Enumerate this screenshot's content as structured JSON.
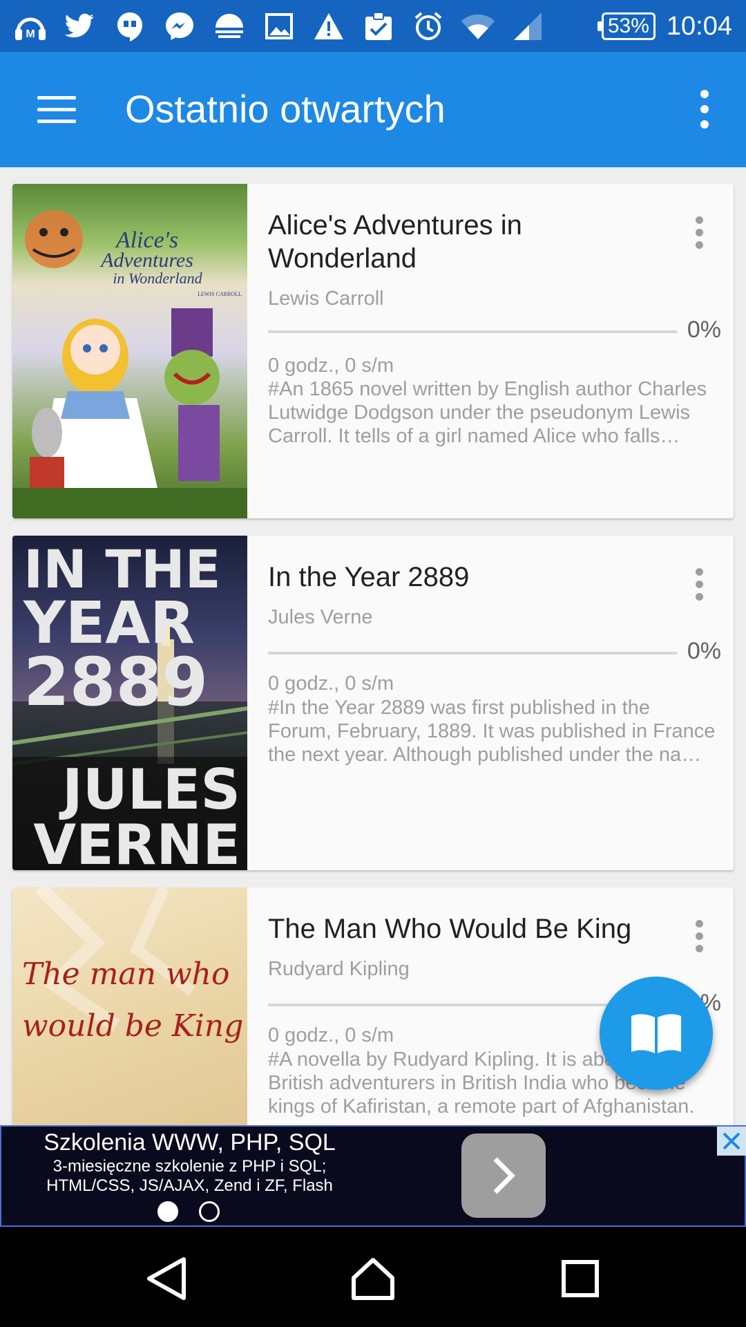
{
  "status_bar": {
    "icons": [
      "headphones-m-icon",
      "twitter-icon",
      "hangouts-icon",
      "messenger-icon",
      "weather-icon",
      "image-icon",
      "warning-icon",
      "clipboard-check-icon",
      "alarm-icon",
      "wifi-icon",
      "signal-icon"
    ],
    "battery": "53%",
    "time": "10:04"
  },
  "app_bar": {
    "title": "Ostatnio otwartych"
  },
  "books": [
    {
      "title": "Alice's Adventures in Wonderland",
      "author": "Lewis Carroll",
      "progress": 0,
      "percent": "0%",
      "time": "0 godz., 0 s/m",
      "description": "#An 1865 novel written by English author Charles Lutwidge Dodgson under the pseudonym Lewis Carroll. It tells of a girl named Alice who falls through a rabbit hole into a fantasy world."
    },
    {
      "title": "In the Year 2889",
      "author": "Jules Verne",
      "progress": 0,
      "percent": "0%",
      "time": "0 godz., 0 s/m",
      "description": "#In the Year 2889 was first published in the Forum, February, 1889. It was published in France the next year. Although published under the name of Jules Verne, it is now believed to be the work of his son Michel."
    },
    {
      "title": "The Man Who Would Be King",
      "author": "Rudyard Kipling",
      "progress": 0,
      "percent": "0%",
      "time": "0 godz., 0 s/m",
      "description": "#A novella by Rudyard Kipling. It is about two British adventurers in British India who become kings of Kafiristan, a remote part of Afghanistan."
    }
  ],
  "covers": {
    "alice": {
      "line1": "Alice's",
      "line2": "Adventures",
      "line3": "in Wonderland",
      "byline": "LEWIS CARROLL"
    },
    "year2889": {
      "line1": "IN THE",
      "line2": "YEAR",
      "line3": "2889",
      "line4": "JULES",
      "line5": "VERNE"
    },
    "king": {
      "line1": "The man who",
      "line2": "would be King"
    }
  },
  "ad": {
    "title": "Szkolenia WWW, PHP, SQL",
    "subtitle_line1": "3-miesięczne szkolenie z PHP i SQL;",
    "subtitle_line2": "HTML/CSS, JS/AJAX, Zend i ZF, Flash",
    "page_count": 2,
    "active_page": 1
  },
  "colors": {
    "status_bar": "#1565C0",
    "app_bar": "#1E88E5",
    "fab": "#1E9BE8",
    "background": "#EEEEEE"
  }
}
